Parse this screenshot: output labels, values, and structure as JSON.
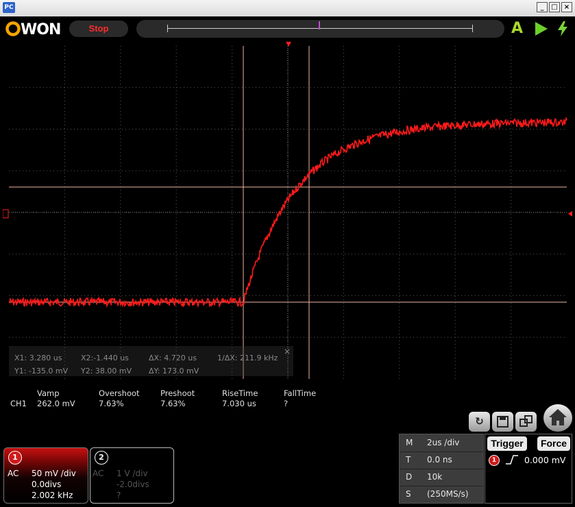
{
  "window": {
    "app_icon": "PC",
    "controls": {
      "minimize": "_",
      "maximize": "□",
      "close": "×"
    }
  },
  "toolbar": {
    "logo": "OWON",
    "run_state": "Stop",
    "icons": [
      "auto-set-icon",
      "run-icon",
      "single-trigger-icon"
    ],
    "accent_logo": "#f5a400",
    "stop_color": "#ff2b2b"
  },
  "waveform": {
    "color": "#ff1a1a",
    "grid_color": "#5a5a5a",
    "cursor_color": "#f0b6a0"
  },
  "cursors": {
    "x1": "X1: 3.280 us",
    "x2": "X2:-1.440 us",
    "dx": "ΔX: 4.720 us",
    "inv_dx": "1/ΔX: 211.9 kHz",
    "y1": "Y1: -135.0 mV",
    "y2": "Y2: 38.00 mV",
    "dy": "ΔY: 173.0 mV",
    "close": "×"
  },
  "measurements": {
    "channel": "CH1",
    "columns": [
      {
        "label": "Vamp",
        "value": "262.0 mV"
      },
      {
        "label": "Overshoot",
        "value": "7.63%"
      },
      {
        "label": "Preshoot",
        "value": "7.63%"
      },
      {
        "label": "RiseTime",
        "value": "7.030 us"
      },
      {
        "label": "FallTime",
        "value": "?"
      }
    ]
  },
  "ch1": {
    "number": "1",
    "coupling": "AC",
    "scale": "50 mV /div",
    "offset": "0.0divs",
    "freq": "2.002 kHz",
    "color": "#ff1a1a"
  },
  "ch2": {
    "number": "2",
    "coupling": "AC",
    "scale": "1 V /div",
    "offset": "-2.0divs",
    "freq": "?"
  },
  "horizontal": {
    "rows": [
      {
        "key": "M",
        "value": "2us /div"
      },
      {
        "key": "T",
        "value": "0.0 ns"
      },
      {
        "key": "D",
        "value": "10k"
      },
      {
        "key": "S",
        "value": "(250MS/s)"
      }
    ]
  },
  "trigger": {
    "trigger_label": "Trigger",
    "force_label": "Force",
    "source": "1",
    "level": "0.000 mV"
  },
  "bottom_icons": [
    "return-icon",
    "save-icon",
    "window-icon",
    "home-icon"
  ]
}
